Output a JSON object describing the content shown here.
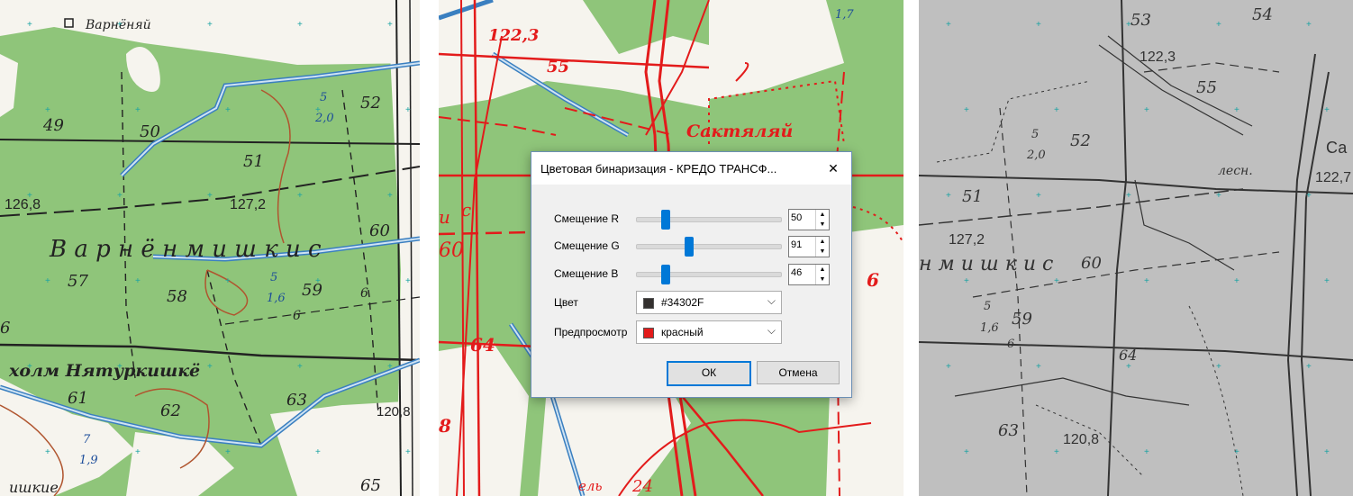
{
  "dialog": {
    "title": "Цветовая бинаризация - КРЕДО ТРАНСФ...",
    "close_glyph": "✕",
    "offset_r": {
      "label": "Смещение R",
      "value": "50",
      "fraction": 0.2
    },
    "offset_g": {
      "label": "Смещение G",
      "value": "91",
      "fraction": 0.36
    },
    "offset_b": {
      "label": "Смещение B",
      "value": "46",
      "fraction": 0.2
    },
    "color": {
      "label": "Цвет",
      "value": "#34302F",
      "swatch": "#34302F"
    },
    "preview": {
      "label": "Предпросмотр",
      "value": "красный",
      "swatch": "#e31b1b"
    },
    "ok_label": "ОК",
    "cancel_label": "Отмена",
    "spin_up": "▲",
    "spin_down": "▼",
    "chevron": "⌵"
  },
  "map_left": {
    "labels": {
      "village": "Варнёняй",
      "n49": "49",
      "n50": "50",
      "n51": "51",
      "n52": "52",
      "n57": "57",
      "n58": "58",
      "n59": "59",
      "n60": "60",
      "n61": "61",
      "n62": "62",
      "n63": "63",
      "n65": "65",
      "elev1": "126,8",
      "elev2": "127,2",
      "elev3": "120,8",
      "frac1_top": "5",
      "frac1_bot": "2,0",
      "frac2_top": "5",
      "frac2_bot": "1,6",
      "frac3_top": "7",
      "frac3_bot": "1,9",
      "region": "В а р н ё н м и ш к и с",
      "hill": "холм Нятуркишкё",
      "bottom": "ишкие",
      "six1": "6",
      "six2": "6",
      "six3": "6"
    }
  },
  "map_mid": {
    "labels": {
      "elev1": "122,3",
      "n55": "55",
      "village": "Сактяляй",
      "frac_top": "1,7",
      "n60": "60",
      "n64": "64",
      "n8": "8",
      "n6": "6",
      "c": "с",
      "u": "и",
      "bottom": "ель",
      "n24": "24"
    }
  },
  "map_right": {
    "labels": {
      "n53": "53",
      "n54": "54",
      "elev1": "122,3",
      "n55": "55",
      "n51": "51",
      "n52": "52",
      "elev2": "127,2",
      "elev3": "122,7",
      "elev4": "120,8",
      "n59": "59",
      "n60": "60",
      "n63": "63",
      "n64": "64",
      "n6": "6",
      "forest": "лесн.",
      "sa": "Са",
      "frac1_top": "5",
      "frac1_bot": "2,0",
      "frac2_top": "5",
      "frac2_bot": "1,6",
      "region": "н м и ш к и с"
    }
  },
  "colors": {
    "map_green": "#8fc57a",
    "map_white": "#f6f4ee",
    "road_black": "#222222",
    "river_blue": "#3a7fc0",
    "contour_brown": "#b0552f",
    "bin_red": "#e31b1b",
    "bin_gray": "#bfbfbf",
    "accent": "#0078d7"
  }
}
